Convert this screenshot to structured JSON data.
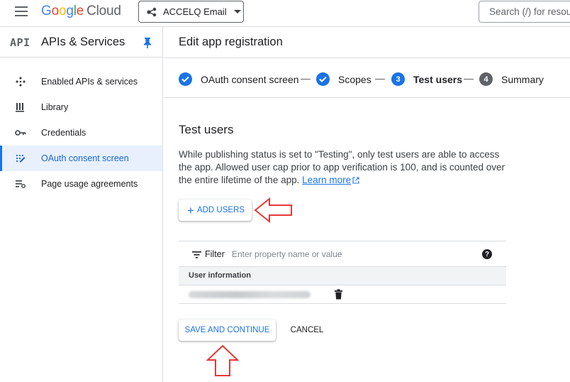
{
  "topbar": {
    "logo_google": "Google",
    "logo_cloud": "Cloud",
    "project_name": "ACCELQ Email",
    "search_placeholder": "Search (/) for resources"
  },
  "sidebar": {
    "api_logo": "API",
    "title": "APIs & Services",
    "items": [
      {
        "label": "Enabled APIs & services",
        "icon": "diamond-dots-icon",
        "active": false
      },
      {
        "label": "Library",
        "icon": "library-icon",
        "active": false
      },
      {
        "label": "Credentials",
        "icon": "key-icon",
        "active": false
      },
      {
        "label": "OAuth consent screen",
        "icon": "oauth-icon",
        "active": true
      },
      {
        "label": "Page usage agreements",
        "icon": "settings-list-icon",
        "active": false
      }
    ]
  },
  "main": {
    "page_title": "Edit app registration",
    "steps": [
      {
        "label": "OAuth consent screen",
        "state": "done"
      },
      {
        "label": "Scopes",
        "state": "done"
      },
      {
        "number": "3",
        "label": "Test users",
        "state": "current"
      },
      {
        "number": "4",
        "label": "Summary",
        "state": "pending"
      }
    ],
    "section_title": "Test users",
    "description": "While publishing status is set to \"Testing\", only test users are able to access the app. Allowed user cap prior to app verification is 100, and is counted over the entire lifetime of the app.",
    "learn_more": "Learn more",
    "add_users_label": "ADD USERS",
    "filter_label": "Filter",
    "filter_placeholder": "Enter property name or value",
    "help_glyph": "?",
    "table_header": "User information",
    "save_label": "SAVE AND CONTINUE",
    "cancel_label": "CANCEL"
  },
  "colors": {
    "accent": "#1a73e8",
    "annotation": "#e53935"
  }
}
